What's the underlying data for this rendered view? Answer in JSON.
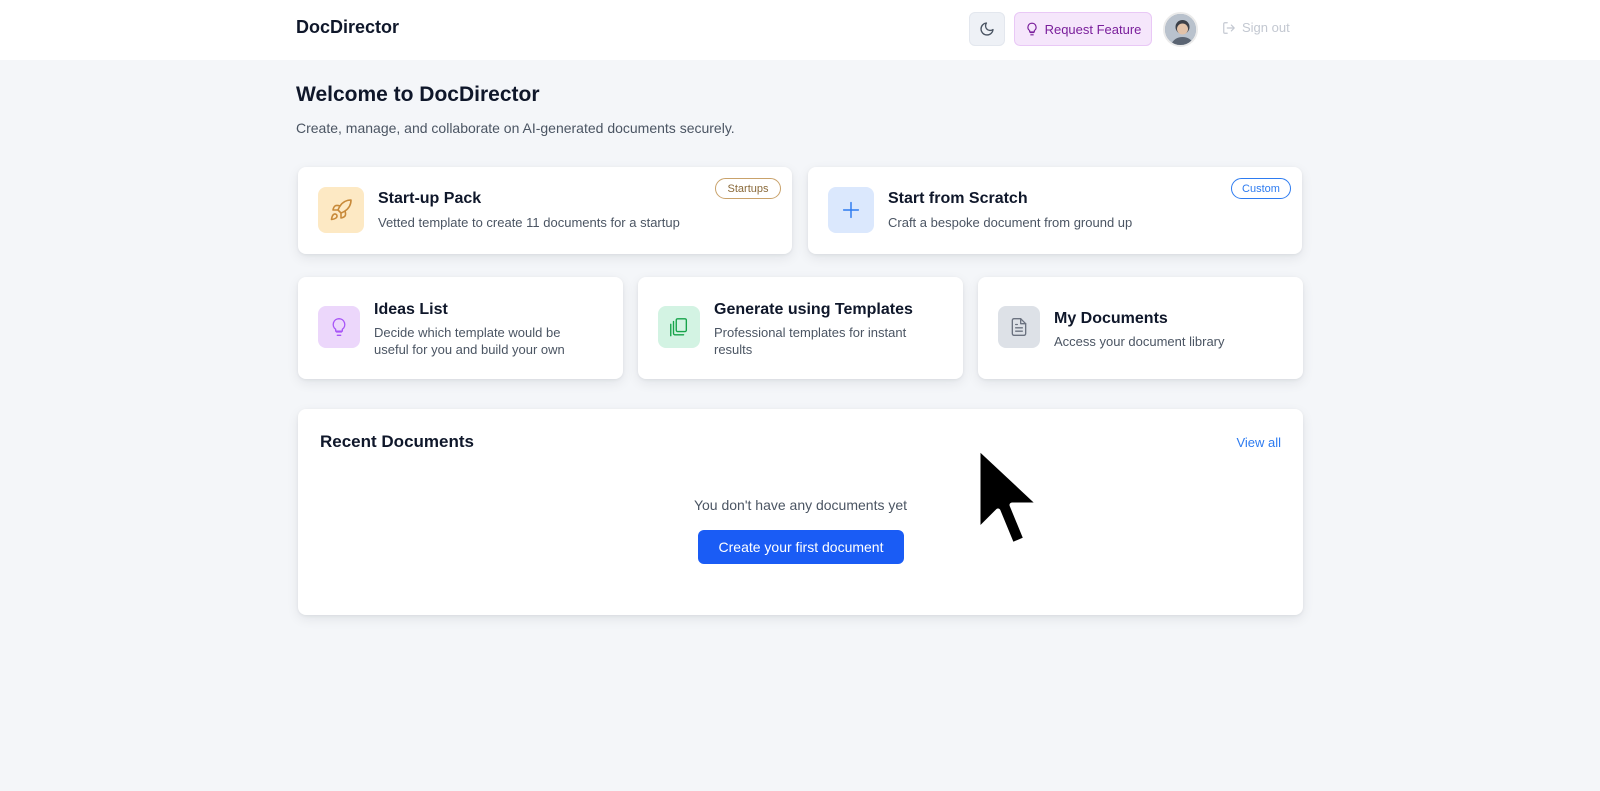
{
  "header": {
    "brand": "DocDirector",
    "request_feature": "Request Feature",
    "sign_out": "Sign out"
  },
  "welcome": {
    "title": "Welcome to DocDirector",
    "subtitle": "Create, manage, and collaborate on AI-generated documents securely."
  },
  "cards": {
    "startup": {
      "title": "Start-up Pack",
      "desc": "Vetted template to create 11 documents for a startup",
      "badge": "Startups"
    },
    "scratch": {
      "title": "Start from Scratch",
      "desc": "Craft a bespoke document from ground up",
      "badge": "Custom"
    },
    "ideas": {
      "title": "Ideas List",
      "desc": "Decide which template would be useful for you and build your own"
    },
    "templates": {
      "title": "Generate using Templates",
      "desc": "Professional templates for instant results"
    },
    "mydocs": {
      "title": "My Documents",
      "desc": "Access your document library"
    }
  },
  "recent": {
    "title": "Recent Documents",
    "view_all": "View all",
    "empty": "You don't have any documents yet",
    "create": "Create your first document"
  },
  "colors": {
    "accent": "#1a5cf5",
    "link": "#2d7bf0",
    "request_bg": "#f5e6fb"
  }
}
